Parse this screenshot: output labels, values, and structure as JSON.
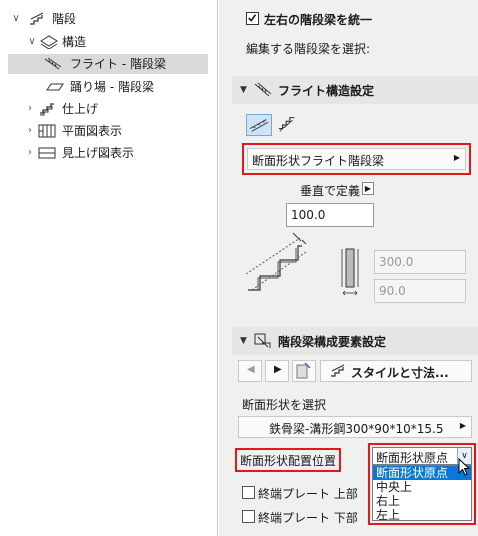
{
  "tree": {
    "items": [
      {
        "label": "階段",
        "icon": "stair-icon"
      },
      {
        "label": "構造",
        "icon": "structure-icon"
      },
      {
        "label": "フライト - 階段梁",
        "icon": "flight-stringer-icon"
      },
      {
        "label": "踊り場 - 階段梁",
        "icon": "landing-stringer-icon"
      },
      {
        "label": "仕上げ",
        "icon": "finish-icon"
      },
      {
        "label": "平面図表示",
        "icon": "floor-plan-icon"
      },
      {
        "label": "見上げ図表示",
        "icon": "reflected-ceiling-icon"
      }
    ]
  },
  "settings": {
    "unify_checkbox_label": "左右の階段梁を統一",
    "select_stringer_label": "編集する階段梁を選択:",
    "flight_section_title": "フライト構造設定",
    "profile_type_button": "断面形状フライト階段梁",
    "vertical_definition_label": "垂直で定義",
    "depth_value": "100.0",
    "dim_top_value": "300.0",
    "dim_bottom_value": "90.0",
    "components_section_title": "階段梁構成要素設定",
    "style_size_button": "スタイルと寸法...",
    "select_profile_label": "断面形状を選択",
    "profile_name": "鉄骨梁-溝形鋼300*90*10*15.5",
    "profile_placement_label": "断面形状配置位置",
    "placement_selected": "断面形状原点",
    "placement_options": [
      "断面形状原点",
      "中央上",
      "右上",
      "左上"
    ],
    "end_plate_top_label": "終端プレート 上部",
    "end_plate_bottom_label": "終端プレート 下部"
  },
  "colors": {
    "highlight_red": "#e2191a",
    "selection_blue": "#0a78d7"
  }
}
